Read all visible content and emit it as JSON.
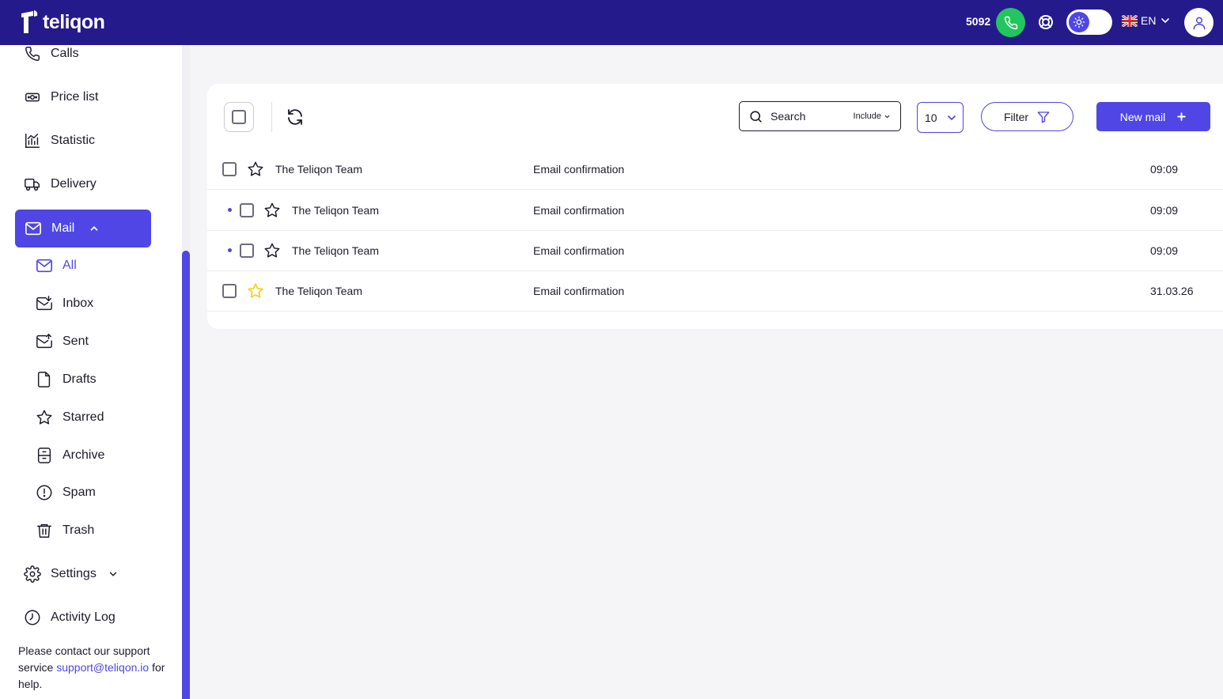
{
  "header": {
    "logo_text": "teliqon",
    "balance": "5092",
    "language": "EN"
  },
  "sidebar": {
    "items": [
      {
        "label": "Calls",
        "icon": "phone-icon"
      },
      {
        "label": "Price list",
        "icon": "price-tag-icon"
      },
      {
        "label": "Statistic",
        "icon": "chart-icon"
      },
      {
        "label": "Delivery",
        "icon": "truck-icon"
      }
    ],
    "mail": {
      "label": "Mail",
      "icon": "mail-icon"
    },
    "mail_sub": [
      {
        "label": "All",
        "icon": "mail-icon"
      },
      {
        "label": "Inbox",
        "icon": "inbox-icon"
      },
      {
        "label": "Sent",
        "icon": "sent-icon"
      },
      {
        "label": "Drafts",
        "icon": "draft-icon"
      },
      {
        "label": "Starred",
        "icon": "star-icon"
      },
      {
        "label": "Archive",
        "icon": "archive-icon"
      },
      {
        "label": "Spam",
        "icon": "alert-icon"
      },
      {
        "label": "Trash",
        "icon": "trash-icon"
      }
    ],
    "settings": {
      "label": "Settings",
      "icon": "gear-icon"
    },
    "activity": {
      "label": "Activity Log",
      "icon": "clock-icon"
    },
    "support": {
      "text_before": "Please contact our support service ",
      "email": "support@teliqon.io",
      "text_after": " for help."
    }
  },
  "toolbar": {
    "search_placeholder": "Search",
    "include_label": "Include",
    "per_page": "10",
    "filter_label": "Filter",
    "new_mail_label": "New mail"
  },
  "mails": [
    {
      "sender": "The Teliqon Team",
      "subject": "Email confirmation",
      "time": "09:09",
      "unread": false,
      "starred": false
    },
    {
      "sender": "The Teliqon Team",
      "subject": "Email confirmation",
      "time": "09:09",
      "unread": true,
      "starred": false
    },
    {
      "sender": "The Teliqon Team",
      "subject": "Email confirmation",
      "time": "09:09",
      "unread": true,
      "starred": false
    },
    {
      "sender": "The Teliqon Team",
      "subject": "Email confirmation",
      "time": "31.03.26",
      "unread": false,
      "starred": true
    }
  ],
  "colors": {
    "header_bg": "#241a8c",
    "accent": "#4f46e5",
    "call_green": "#22c55e",
    "star_yellow": "#facc15"
  }
}
